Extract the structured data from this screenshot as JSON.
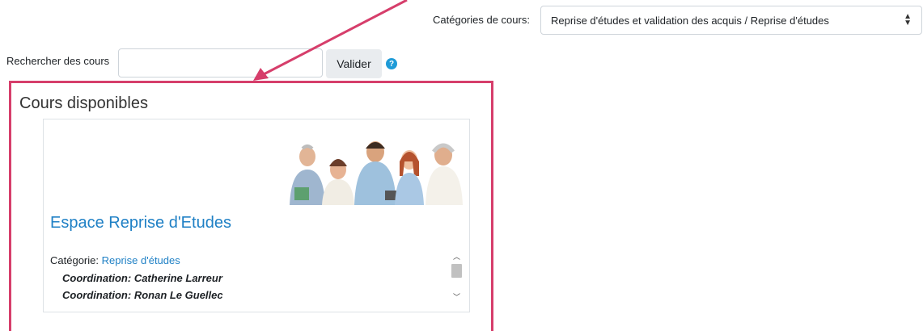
{
  "category_filter": {
    "label": "Catégories de cours:",
    "selected": "Reprise d'études et validation des acquis / Reprise d'études",
    "arrow_glyph": "◆"
  },
  "search": {
    "label": "Rechercher des cours",
    "value": "",
    "button_label": "Valider",
    "help_glyph": "?"
  },
  "available_courses": {
    "heading": "Cours disponibles",
    "course": {
      "image_icon": "group-photo-icon",
      "title": "Espace Reprise d'Etudes",
      "category_label": "Catégorie: ",
      "category_link": "Reprise d'études",
      "coordinators": [
        "Coordination: Catherine Larreur",
        "Coordination: Ronan Le Guellec"
      ]
    }
  },
  "colors": {
    "annotation": "#d63e6b",
    "link": "#1f80c5",
    "help": "#1f9bd7"
  }
}
